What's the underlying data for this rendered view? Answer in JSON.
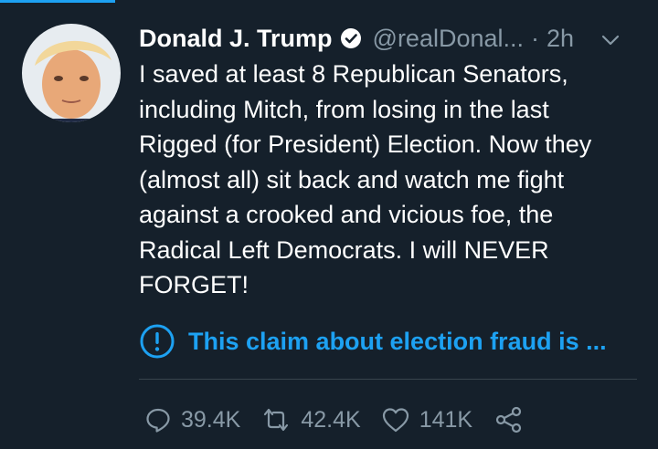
{
  "tweet": {
    "author_name": "Donald J. Trump",
    "handle": "@realDonal...",
    "separator": "·",
    "timestamp": "2h",
    "text": "I saved at least 8 Republican Senators,\nincluding Mitch, from losing in the last\nRigged (for President) Election. Now they\n(almost all) sit back and watch me fight\nagainst a crooked and vicious foe, the\nRadical Left Democrats. I will NEVER\nFORGET!",
    "notice": "This claim about election fraud is ...",
    "stats": {
      "replies": "39.4K",
      "retweets": "42.4K",
      "likes": "141K"
    }
  },
  "icons": {
    "verified": "verified-badge-icon",
    "menu": "chevron-down-icon",
    "notice": "exclamation-circle-icon",
    "reply": "reply-bubble-icon",
    "retweet": "retweet-icon",
    "like": "heart-icon",
    "share": "share-icon"
  },
  "colors": {
    "background": "#15202b",
    "accent": "#1da1f2",
    "secondary_text": "#8899a6",
    "divider": "#38444d"
  }
}
